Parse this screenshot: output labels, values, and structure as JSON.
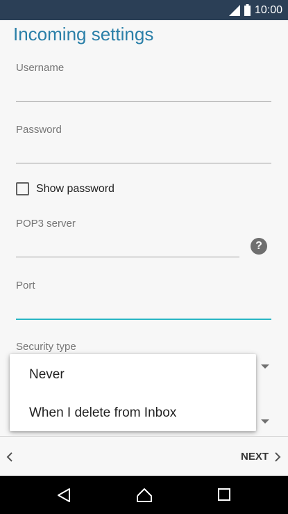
{
  "status_bar": {
    "time": "10:00"
  },
  "title": "Incoming settings",
  "fields": {
    "username": {
      "label": "Username",
      "value": ""
    },
    "password": {
      "label": "Password",
      "value": ""
    },
    "show_password": {
      "label": "Show password",
      "checked": false
    },
    "pop3_server": {
      "label": "POP3 server",
      "value": ""
    },
    "port": {
      "label": "Port",
      "value": ""
    },
    "security_type": {
      "label": "Security type"
    }
  },
  "popup": {
    "options": [
      "Never",
      "When I delete from Inbox"
    ]
  },
  "bottom_nav": {
    "next_label": "NEXT"
  },
  "colors": {
    "title": "#2a7fa8",
    "active_underline": "#29b6c4",
    "status_bar": "#2b3f56"
  }
}
